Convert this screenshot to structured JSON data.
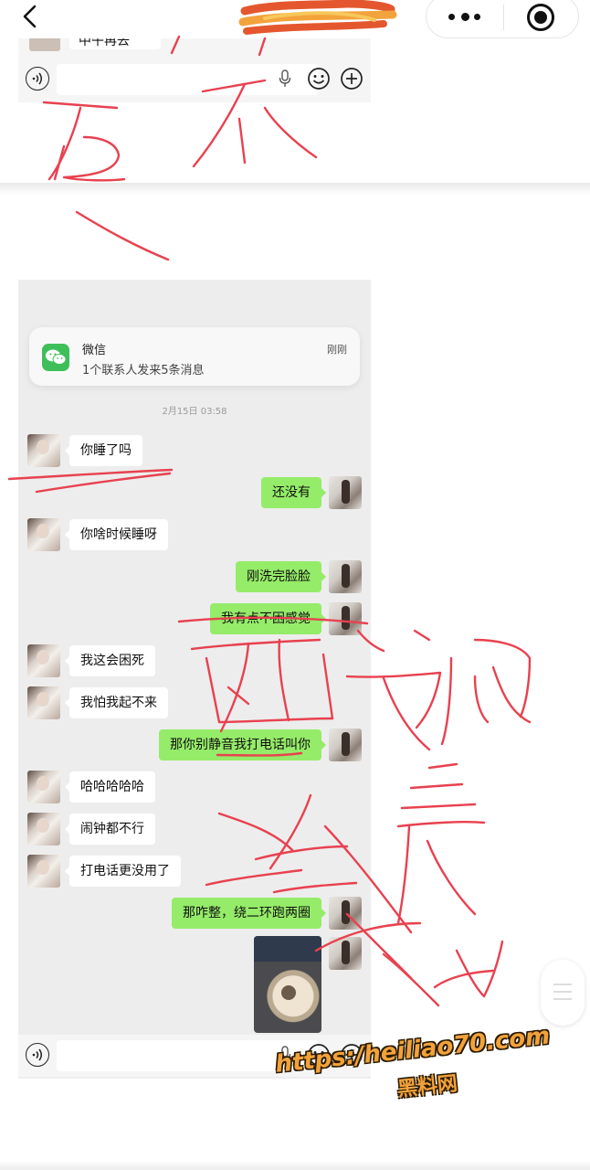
{
  "colors": {
    "page_bg": "#ffffff",
    "chat_bg": "#ededed",
    "bubble_received": "#ffffff",
    "bubble_sent": "#95ec69",
    "wechat_green": "#3fbf5a",
    "annotation_red": "#e8414f",
    "watermark_orange": "#f2a23a"
  },
  "nav": {
    "back_icon": "chevron-left-icon",
    "more_icon": "more-dots-icon",
    "close_icon": "target-close-icon"
  },
  "top_screenshot": {
    "cut_off_text": "中午再去"
  },
  "notification": {
    "app_name": "微信",
    "message": "1个联系人发来5条消息",
    "time": "刚刚"
  },
  "chat": {
    "timestamp": "2月15日 03:58",
    "messages": [
      {
        "from": "her",
        "text": "你睡了吗"
      },
      {
        "from": "me",
        "text": "还没有"
      },
      {
        "from": "her",
        "text": "你啥时候睡呀"
      },
      {
        "from": "me",
        "text": "刚洗完脸脸"
      },
      {
        "from": "me",
        "text": "我有点不困感觉"
      },
      {
        "from": "her",
        "text": "我这会困死"
      },
      {
        "from": "her",
        "text": "我怕我起不来"
      },
      {
        "from": "me",
        "text": "那你别静音我打电话叫你"
      },
      {
        "from": "her",
        "text": "哈哈哈哈哈"
      },
      {
        "from": "her",
        "text": "闹钟都不行"
      },
      {
        "from": "her",
        "text": "打电话更没用了"
      },
      {
        "from": "me",
        "text": "那咋整，绕二环跑两圈"
      },
      {
        "from": "me",
        "type": "image",
        "text": ""
      }
    ]
  },
  "input_bar": {
    "voice_icon": "voice-icon",
    "mic_icon": "mic-icon",
    "emoji_icon": "emoji-icon",
    "plus_icon": "plus-icon",
    "placeholder": ""
  },
  "watermark": {
    "url": "https:/heiliao70.com",
    "name": "黑料网"
  }
}
